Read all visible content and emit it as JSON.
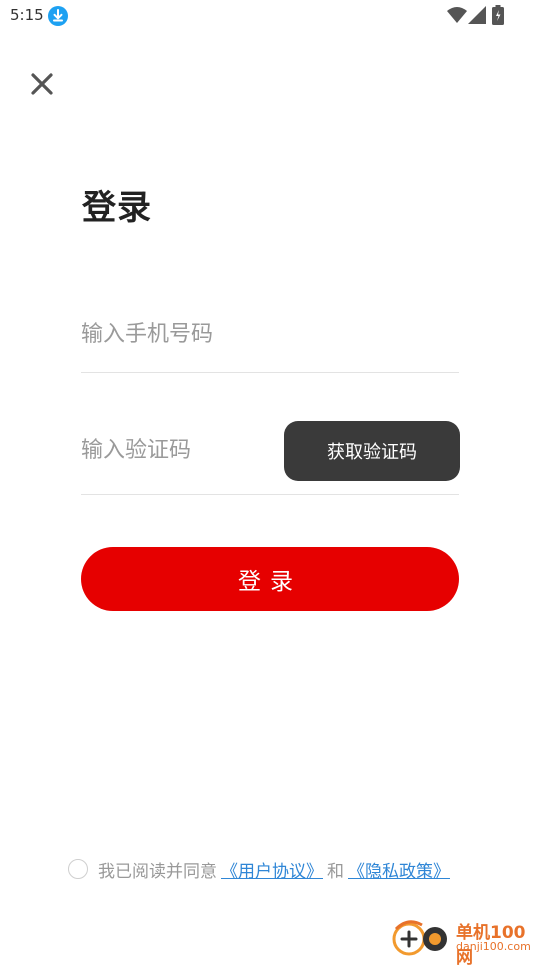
{
  "status_bar": {
    "time": "5:15",
    "icons": [
      "download-icon",
      "wifi-icon",
      "signal-icon",
      "battery-icon"
    ]
  },
  "header": {
    "close_icon": "close-icon",
    "title": "登录"
  },
  "form": {
    "phone_placeholder": "输入手机号码",
    "phone_value": "",
    "code_placeholder": "输入验证码",
    "code_value": "",
    "get_code_label": "获取验证码",
    "login_label": "登录"
  },
  "agreement": {
    "checked": false,
    "prefix": "我已阅读并同意",
    "user_agreement": "《用户协议》",
    "connector": "和",
    "privacy_policy": "《隐私政策》"
  },
  "watermark": {
    "name": "单机100网",
    "url": "danji100.com"
  },
  "colors": {
    "primary_red": "#e60000",
    "dark_button": "#3a3a3a",
    "link_blue": "#2f86d6",
    "placeholder_gray": "#9a9a9a",
    "watermark_orange": "#e8722a"
  }
}
